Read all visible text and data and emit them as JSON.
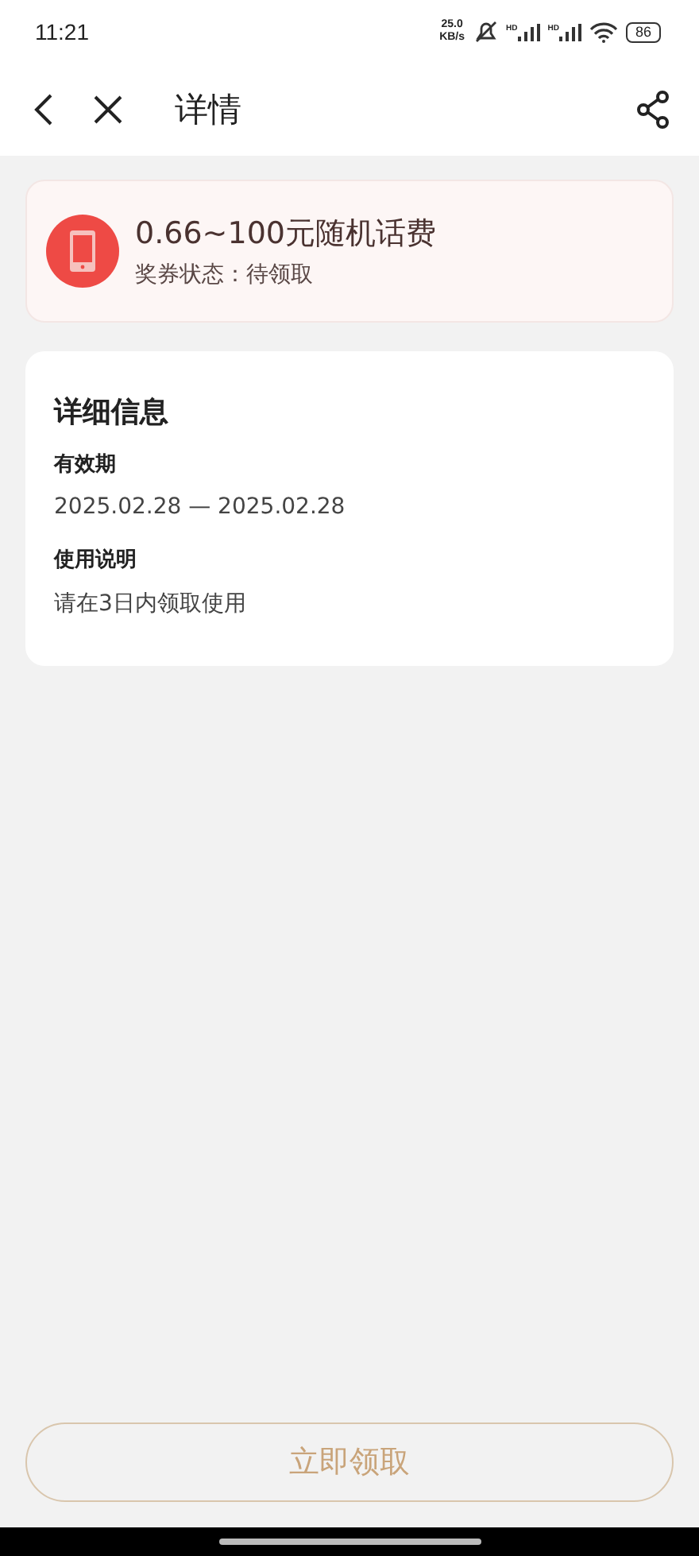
{
  "status_bar": {
    "time": "11:21",
    "net_speed_value": "25.0",
    "net_speed_unit": "KB/s",
    "signal_1_label": "HD",
    "signal_2_label": "HD",
    "battery": "86"
  },
  "header": {
    "title": "详情"
  },
  "coupon": {
    "title": "0.66~100元随机话费",
    "status": "奖券状态：待领取"
  },
  "details": {
    "heading": "详细信息",
    "fields": [
      {
        "label": "有效期",
        "value": "2025.02.28 — 2025.02.28"
      },
      {
        "label": "使用说明",
        "value": "请在3日内领取使用"
      }
    ]
  },
  "claim_button": {
    "label": "立即领取"
  }
}
